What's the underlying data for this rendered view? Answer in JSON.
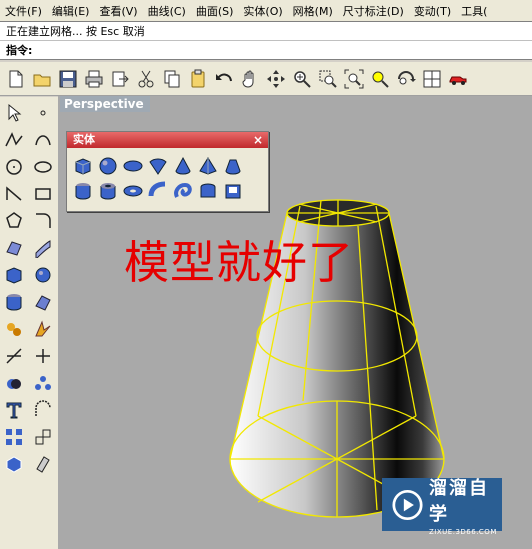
{
  "menubar": {
    "items": [
      "文件(F)",
      "编辑(E)",
      "查看(V)",
      "曲线(C)",
      "曲面(S)",
      "实体(O)",
      "网格(M)",
      "尺寸标注(D)",
      "变动(T)",
      "工具("
    ]
  },
  "command": {
    "history": "正在建立网格... 按 Esc 取消",
    "prompt": "指令:"
  },
  "toolbar": {
    "icons": [
      "new-icon",
      "open-icon",
      "save-icon",
      "print-icon",
      "import-icon",
      "cut-icon",
      "copy-icon",
      "paste-icon",
      "undo-icon",
      "pan-icon",
      "rotate-view-icon",
      "zoom-icon",
      "zoom-window-icon",
      "zoom-extents-icon",
      "zoom-selected-icon",
      "view-manage-icon",
      "four-view-icon",
      "car-icon"
    ]
  },
  "viewport": {
    "label": "Perspective"
  },
  "solid_panel": {
    "title": "实体",
    "close": "×"
  },
  "overlay": {
    "text": "模型就好了"
  },
  "watermark": {
    "brand": "溜溜自学",
    "url": "ZIXUE.3D66.COM"
  },
  "colors": {
    "viewport_bg": "#a9a9a9",
    "overlay_red": "#e60000",
    "wireframe_yellow": "#f2e800",
    "panel_title_red": "#c0292c"
  }
}
